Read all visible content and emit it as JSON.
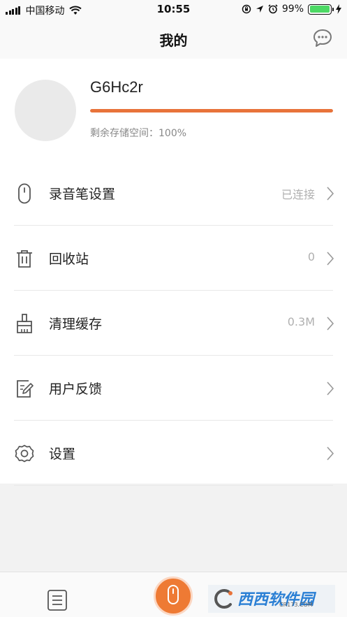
{
  "status_bar": {
    "carrier": "中国移动",
    "time": "10:55",
    "battery_percent": "99%",
    "battery_level": 0.99,
    "icons": [
      "signal-icon",
      "wifi-icon",
      "orientation-lock-icon",
      "location-icon",
      "alarm-icon",
      "battery-icon",
      "charging-icon"
    ]
  },
  "nav": {
    "title": "我的",
    "message_icon": "chat-bubble-icon"
  },
  "profile": {
    "username": "G6Hc2r",
    "storage_text": "剩余存储空间：100%",
    "storage_fraction": 1.0,
    "accent_color": "#e8733a"
  },
  "menu": [
    {
      "label": "录音笔设置",
      "value": "已连接",
      "icon": "recorder-pen-icon"
    },
    {
      "label": "回收站",
      "value": "0",
      "icon": "trash-icon"
    },
    {
      "label": "清理缓存",
      "value": "0.3M",
      "icon": "broom-icon"
    },
    {
      "label": "用户反馈",
      "value": "",
      "icon": "feedback-edit-icon"
    },
    {
      "label": "设置",
      "value": "",
      "icon": "gear-icon"
    }
  ],
  "tab_bar": {
    "list_icon": "document-list-icon",
    "record_icon": "recorder-icon",
    "record_color": "#ee7a34"
  },
  "watermark": {
    "text": "西西软件园",
    "subtext": "CR173.COM"
  }
}
